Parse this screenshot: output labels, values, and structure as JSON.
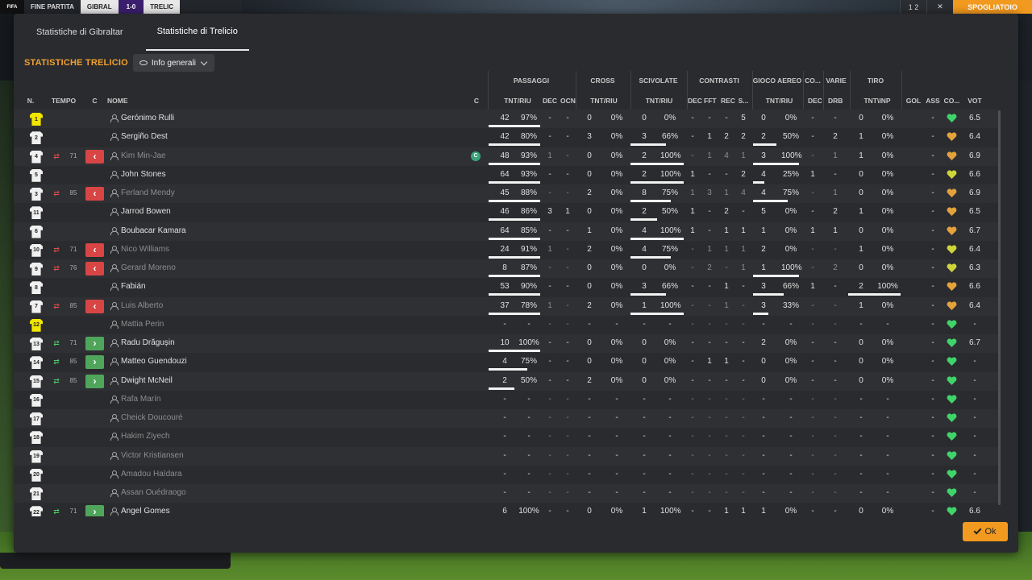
{
  "topbar": {
    "match_state": "FINE PARTITA",
    "team_a": "GIBRAL",
    "score": "1-0",
    "team_b": "TRELIC",
    "ctrl_a": "1 2",
    "ctrl_b": "✕",
    "main_button": "SPOGLIATOIO"
  },
  "tabs": [
    {
      "label": "Statistiche di Gibraltar"
    },
    {
      "label": "Statistiche di Trelicio"
    }
  ],
  "section": {
    "title": "STATISTICHE TRELICIO",
    "dropdown": "Info generali"
  },
  "groups": [
    "PASSAGGI",
    "CROSS",
    "SCIVOLATE",
    "CONTRASTI",
    "GIOCO AEREO",
    "CO...",
    "VARIE",
    "TIRO"
  ],
  "columns": {
    "n": "N.",
    "tempo": "TEMPO",
    "c": "C",
    "nome": "NOME",
    "c2": "C",
    "pass_tr": "TNT/RIU",
    "pass_dec": "DEC",
    "pass_ocn": "OCN",
    "cross_tr": "TNT/RIU",
    "tack_tr": "TNT/RIU",
    "con_dec": "DEC",
    "con_fft": "FFT",
    "con_rec": "REC",
    "con_s": "S...",
    "air_tr": "TNT/RIU",
    "co_dec": "DEC",
    "var_drb": "DRB",
    "tiro_tr": "TNT\\INP",
    "gol": "GOL",
    "ass": "ASS",
    "co": "CO...",
    "vot": "VOT"
  },
  "players": [
    {
      "n": "1",
      "gk": true,
      "name": "Gerónimo Rulli",
      "dim": false,
      "pt": "42",
      "pp": "97%",
      "pbar": 1,
      "pd": "-",
      "po": "-",
      "ct": "0",
      "cp": "0%",
      "st": "0",
      "sp": "0%",
      "sbar": 0,
      "cd": "-",
      "cf": "-",
      "cr": "-",
      "cs": "5",
      "at": "0",
      "ap": "0%",
      "abar": 0,
      "co": "-",
      "dr": "-",
      "tt": "0",
      "tp": "0%",
      "tbar": 0,
      "gol": "",
      "ass": "-",
      "heart": "green",
      "vot": "6.5"
    },
    {
      "n": "2",
      "name": "Sergiño Dest",
      "dim": false,
      "pt": "42",
      "pp": "80%",
      "pbar": 1,
      "pd": "-",
      "po": "-",
      "ct": "3",
      "cp": "0%",
      "st": "3",
      "sp": "66%",
      "sbar": 0.66,
      "cd": "-",
      "cf": "1",
      "cr": "2",
      "cs": "2",
      "at": "2",
      "ap": "50%",
      "abar": 0.5,
      "co": "-",
      "dr": "2",
      "tt": "1",
      "tp": "0%",
      "tbar": 0,
      "gol": "",
      "ass": "-",
      "heart": "orange",
      "vot": "6.4"
    },
    {
      "n": "4",
      "name": "Kim Min-Jae",
      "dim": true,
      "sub": "out",
      "min": "71",
      "capt": "C",
      "pt": "48",
      "pp": "93%",
      "pbar": 1,
      "pd": "1",
      "po": "-",
      "ct": "0",
      "cp": "0%",
      "st": "2",
      "sp": "100%",
      "sbar": 1,
      "cd": "-",
      "cf": "1",
      "cr": "4",
      "cs": "1",
      "at": "3",
      "ap": "100%",
      "abar": 1,
      "co": "-",
      "dr": "1",
      "tt": "1",
      "tp": "0%",
      "tbar": 0,
      "gol": "",
      "ass": "-",
      "heart": "orange",
      "vot": "6.9"
    },
    {
      "n": "5",
      "name": "John Stones",
      "dim": false,
      "pt": "64",
      "pp": "93%",
      "pbar": 1,
      "pd": "-",
      "po": "-",
      "ct": "0",
      "cp": "0%",
      "st": "2",
      "sp": "100%",
      "sbar": 1,
      "cd": "1",
      "cf": "-",
      "cr": "-",
      "cs": "2",
      "at": "4",
      "ap": "25%",
      "abar": 0.25,
      "co": "1",
      "dr": "-",
      "tt": "0",
      "tp": "0%",
      "tbar": 0,
      "gol": "",
      "ass": "-",
      "heart": "yellow",
      "vot": "6.6"
    },
    {
      "n": "3",
      "name": "Ferland Mendy",
      "dim": true,
      "sub": "out",
      "min": "85",
      "pt": "45",
      "pp": "88%",
      "pbar": 1,
      "pd": "-",
      "po": "-",
      "ct": "2",
      "cp": "0%",
      "st": "8",
      "sp": "75%",
      "sbar": 0.75,
      "cd": "1",
      "cf": "3",
      "cr": "1",
      "cs": "4",
      "at": "4",
      "ap": "75%",
      "abar": 0.75,
      "co": "-",
      "dr": "1",
      "tt": "0",
      "tp": "0%",
      "tbar": 0,
      "gol": "",
      "ass": "-",
      "heart": "orange",
      "vot": "6.9"
    },
    {
      "n": "11",
      "name": "Jarrod Bowen",
      "dim": false,
      "pt": "46",
      "pp": "86%",
      "pbar": 1,
      "pd": "3",
      "po": "1",
      "ct": "0",
      "cp": "0%",
      "st": "2",
      "sp": "50%",
      "sbar": 0.5,
      "cd": "1",
      "cf": "-",
      "cr": "2",
      "cs": "-",
      "at": "5",
      "ap": "0%",
      "abar": 0,
      "co": "-",
      "dr": "2",
      "tt": "1",
      "tp": "0%",
      "tbar": 0,
      "gol": "",
      "ass": "-",
      "heart": "orange",
      "vot": "6.5"
    },
    {
      "n": "6",
      "name": "Boubacar Kamara",
      "dim": false,
      "pt": "64",
      "pp": "85%",
      "pbar": 1,
      "pd": "-",
      "po": "-",
      "ct": "1",
      "cp": "0%",
      "st": "4",
      "sp": "100%",
      "sbar": 1,
      "cd": "1",
      "cf": "-",
      "cr": "1",
      "cs": "1",
      "at": "1",
      "ap": "0%",
      "abar": 0,
      "co": "1",
      "dr": "1",
      "tt": "0",
      "tp": "0%",
      "tbar": 0,
      "gol": "",
      "ass": "-",
      "heart": "orange",
      "vot": "6.7"
    },
    {
      "n": "10",
      "name": "Nico Williams",
      "dim": true,
      "sub": "out",
      "min": "71",
      "pt": "24",
      "pp": "91%",
      "pbar": 1,
      "pd": "1",
      "po": "-",
      "ct": "2",
      "cp": "0%",
      "st": "4",
      "sp": "75%",
      "sbar": 0.75,
      "cd": "-",
      "cf": "1",
      "cr": "1",
      "cs": "1",
      "at": "2",
      "ap": "0%",
      "abar": 0,
      "co": "-",
      "dr": "-",
      "tt": "1",
      "tp": "0%",
      "tbar": 0,
      "gol": "",
      "ass": "-",
      "heart": "yellow",
      "vot": "6.4"
    },
    {
      "n": "9",
      "name": "Gerard Moreno",
      "dim": true,
      "sub": "out",
      "min": "76",
      "pt": "8",
      "pp": "87%",
      "pbar": 1,
      "pd": "-",
      "po": "-",
      "ct": "0",
      "cp": "0%",
      "st": "0",
      "sp": "0%",
      "sbar": 0,
      "cd": "-",
      "cf": "2",
      "cr": "-",
      "cs": "1",
      "at": "1",
      "ap": "100%",
      "abar": 1,
      "co": "-",
      "dr": "2",
      "tt": "0",
      "tp": "0%",
      "tbar": 0,
      "gol": "",
      "ass": "-",
      "heart": "yellow",
      "vot": "6.3"
    },
    {
      "n": "8",
      "name": "Fabián",
      "dim": false,
      "pt": "53",
      "pp": "90%",
      "pbar": 1,
      "pd": "-",
      "po": "-",
      "ct": "0",
      "cp": "0%",
      "st": "3",
      "sp": "66%",
      "sbar": 0.66,
      "cd": "-",
      "cf": "-",
      "cr": "1",
      "cs": "-",
      "at": "3",
      "ap": "66%",
      "abar": 0.66,
      "co": "1",
      "dr": "-",
      "tt": "2",
      "tp": "100%",
      "tbar": 1,
      "gol": "",
      "ass": "-",
      "heart": "orange",
      "vot": "6.6"
    },
    {
      "n": "7",
      "name": "Luis Alberto",
      "dim": true,
      "sub": "out",
      "min": "85",
      "pt": "37",
      "pp": "78%",
      "pbar": 1,
      "pd": "1",
      "po": "-",
      "ct": "2",
      "cp": "0%",
      "st": "1",
      "sp": "100%",
      "sbar": 1,
      "cd": "-",
      "cf": "-",
      "cr": "1",
      "cs": "-",
      "at": "3",
      "ap": "33%",
      "abar": 0.33,
      "co": "-",
      "dr": "-",
      "tt": "1",
      "tp": "0%",
      "tbar": 0,
      "gol": "",
      "ass": "-",
      "heart": "orange",
      "vot": "6.4"
    },
    {
      "n": "12",
      "gk": true,
      "name": "Mattia Perin",
      "dim": true,
      "pt": "-",
      "pp": "-",
      "pbar": 0,
      "pd": "-",
      "po": "-",
      "ct": "-",
      "cp": "-",
      "st": "-",
      "sp": "-",
      "sbar": 0,
      "cd": "-",
      "cf": "-",
      "cr": "-",
      "cs": "-",
      "at": "-",
      "ap": "-",
      "abar": 0,
      "co": "-",
      "dr": "-",
      "tt": "-",
      "tp": "-",
      "tbar": 0,
      "gol": "",
      "ass": "-",
      "heart": "green",
      "vot": "-"
    },
    {
      "n": "13",
      "name": "Radu Drăgușin",
      "dim": false,
      "sub": "in",
      "min": "71",
      "pt": "10",
      "pp": "100%",
      "pbar": 1,
      "pd": "-",
      "po": "-",
      "ct": "0",
      "cp": "0%",
      "st": "0",
      "sp": "0%",
      "sbar": 0,
      "cd": "-",
      "cf": "-",
      "cr": "-",
      "cs": "-",
      "at": "2",
      "ap": "0%",
      "abar": 0,
      "co": "-",
      "dr": "-",
      "tt": "0",
      "tp": "0%",
      "tbar": 0,
      "gol": "",
      "ass": "-",
      "heart": "green",
      "vot": "6.7"
    },
    {
      "n": "14",
      "name": "Matteo Guendouzi",
      "dim": false,
      "sub": "in",
      "min": "85",
      "pt": "4",
      "pp": "75%",
      "pbar": 0.75,
      "pd": "-",
      "po": "-",
      "ct": "0",
      "cp": "0%",
      "st": "0",
      "sp": "0%",
      "sbar": 0,
      "cd": "-",
      "cf": "1",
      "cr": "1",
      "cs": "-",
      "at": "0",
      "ap": "0%",
      "abar": 0,
      "co": "-",
      "dr": "-",
      "tt": "0",
      "tp": "0%",
      "tbar": 0,
      "gol": "",
      "ass": "-",
      "heart": "green",
      "vot": "-"
    },
    {
      "n": "15",
      "name": "Dwight McNeil",
      "dim": false,
      "sub": "in",
      "min": "85",
      "pt": "2",
      "pp": "50%",
      "pbar": 0.5,
      "pd": "-",
      "po": "-",
      "ct": "2",
      "cp": "0%",
      "st": "0",
      "sp": "0%",
      "sbar": 0,
      "cd": "-",
      "cf": "-",
      "cr": "-",
      "cs": "-",
      "at": "0",
      "ap": "0%",
      "abar": 0,
      "co": "-",
      "dr": "-",
      "tt": "0",
      "tp": "0%",
      "tbar": 0,
      "gol": "",
      "ass": "-",
      "heart": "green",
      "vot": "-"
    },
    {
      "n": "16",
      "name": "Rafa Marín",
      "dim": true,
      "pt": "-",
      "pp": "-",
      "pbar": 0,
      "pd": "-",
      "po": "-",
      "ct": "-",
      "cp": "-",
      "st": "-",
      "sp": "-",
      "sbar": 0,
      "cd": "-",
      "cf": "-",
      "cr": "-",
      "cs": "-",
      "at": "-",
      "ap": "-",
      "abar": 0,
      "co": "-",
      "dr": "-",
      "tt": "-",
      "tp": "-",
      "tbar": 0,
      "gol": "",
      "ass": "-",
      "heart": "green",
      "vot": "-"
    },
    {
      "n": "17",
      "name": "Cheick Doucouré",
      "dim": true,
      "pt": "-",
      "pp": "-",
      "pbar": 0,
      "pd": "-",
      "po": "-",
      "ct": "-",
      "cp": "-",
      "st": "-",
      "sp": "-",
      "sbar": 0,
      "cd": "-",
      "cf": "-",
      "cr": "-",
      "cs": "-",
      "at": "-",
      "ap": "-",
      "abar": 0,
      "co": "-",
      "dr": "-",
      "tt": "-",
      "tp": "-",
      "tbar": 0,
      "gol": "",
      "ass": "-",
      "heart": "green",
      "vot": "-"
    },
    {
      "n": "18",
      "name": "Hakim Ziyech",
      "dim": true,
      "pt": "-",
      "pp": "-",
      "pbar": 0,
      "pd": "-",
      "po": "-",
      "ct": "-",
      "cp": "-",
      "st": "-",
      "sp": "-",
      "sbar": 0,
      "cd": "-",
      "cf": "-",
      "cr": "-",
      "cs": "-",
      "at": "-",
      "ap": "-",
      "abar": 0,
      "co": "-",
      "dr": "-",
      "tt": "-",
      "tp": "-",
      "tbar": 0,
      "gol": "",
      "ass": "-",
      "heart": "green",
      "vot": "-"
    },
    {
      "n": "19",
      "name": "Victor Kristiansen",
      "dim": true,
      "pt": "-",
      "pp": "-",
      "pbar": 0,
      "pd": "-",
      "po": "-",
      "ct": "-",
      "cp": "-",
      "st": "-",
      "sp": "-",
      "sbar": 0,
      "cd": "-",
      "cf": "-",
      "cr": "-",
      "cs": "-",
      "at": "-",
      "ap": "-",
      "abar": 0,
      "co": "-",
      "dr": "-",
      "tt": "-",
      "tp": "-",
      "tbar": 0,
      "gol": "",
      "ass": "-",
      "heart": "green",
      "vot": "-"
    },
    {
      "n": "20",
      "name": "Amadou Haïdara",
      "dim": true,
      "pt": "-",
      "pp": "-",
      "pbar": 0,
      "pd": "-",
      "po": "-",
      "ct": "-",
      "cp": "-",
      "st": "-",
      "sp": "-",
      "sbar": 0,
      "cd": "-",
      "cf": "-",
      "cr": "-",
      "cs": "-",
      "at": "-",
      "ap": "-",
      "abar": 0,
      "co": "-",
      "dr": "-",
      "tt": "-",
      "tp": "-",
      "tbar": 0,
      "gol": "",
      "ass": "-",
      "heart": "green",
      "vot": "-"
    },
    {
      "n": "21",
      "name": "Assan Ouédraogo",
      "dim": true,
      "pt": "-",
      "pp": "-",
      "pbar": 0,
      "pd": "-",
      "po": "-",
      "ct": "-",
      "cp": "-",
      "st": "-",
      "sp": "-",
      "sbar": 0,
      "cd": "-",
      "cf": "-",
      "cr": "-",
      "cs": "-",
      "at": "-",
      "ap": "-",
      "abar": 0,
      "co": "-",
      "dr": "-",
      "tt": "-",
      "tp": "-",
      "tbar": 0,
      "gol": "",
      "ass": "-",
      "heart": "green",
      "vot": "-"
    },
    {
      "n": "22",
      "name": "Angel Gomes",
      "dim": false,
      "sub": "in",
      "min": "71",
      "pt": "6",
      "pp": "100%",
      "pbar": 1,
      "pd": "-",
      "po": "-",
      "ct": "0",
      "cp": "0%",
      "st": "1",
      "sp": "100%",
      "sbar": 1,
      "cd": "-",
      "cf": "-",
      "cr": "1",
      "cs": "1",
      "at": "1",
      "ap": "0%",
      "abar": 0,
      "co": "-",
      "dr": "-",
      "tt": "0",
      "tp": "0%",
      "tbar": 0,
      "gol": "",
      "ass": "-",
      "heart": "green",
      "vot": "6.6"
    }
  ],
  "colors": {
    "accent": "#f29a1f",
    "sub_out": "#d84545",
    "sub_in": "#4fa65b",
    "heart_green": "#3fd46a",
    "heart_orange": "#e3a23a",
    "heart_yellow": "#cfd43a"
  },
  "ok_button": "Ok"
}
